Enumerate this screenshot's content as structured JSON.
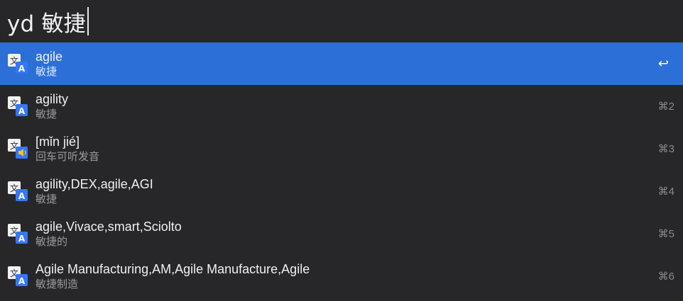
{
  "search": {
    "query": "yd 敏捷"
  },
  "results": [
    {
      "title": "agile",
      "subtitle": "敏捷",
      "shortcut": "↩",
      "icon": "translate-icon",
      "selected": true
    },
    {
      "title": "agility",
      "subtitle": "敏捷",
      "shortcut": "⌘2",
      "icon": "translate-icon"
    },
    {
      "title": "[mǐn jié]",
      "subtitle": "回车可听发音",
      "shortcut": "⌘3",
      "icon": "pronounce-icon"
    },
    {
      "title": "agility,DEX,agile,AGI",
      "subtitle": "敏捷",
      "shortcut": "⌘4",
      "icon": "translate-icon"
    },
    {
      "title": "agile,Vivace,smart,Sciolto",
      "subtitle": "敏捷的",
      "shortcut": "⌘5",
      "icon": "translate-icon"
    },
    {
      "title": "Agile Manufacturing,AM,Agile Manufacture,Agile",
      "subtitle": "敏捷制造",
      "shortcut": "⌘6",
      "icon": "translate-icon"
    }
  ],
  "colors": {
    "selected_row": "#2c6fd6",
    "icon_blue": "#3478f6",
    "icon_white": "#f2f2f2",
    "speaker_yellow": "#f5c518"
  }
}
